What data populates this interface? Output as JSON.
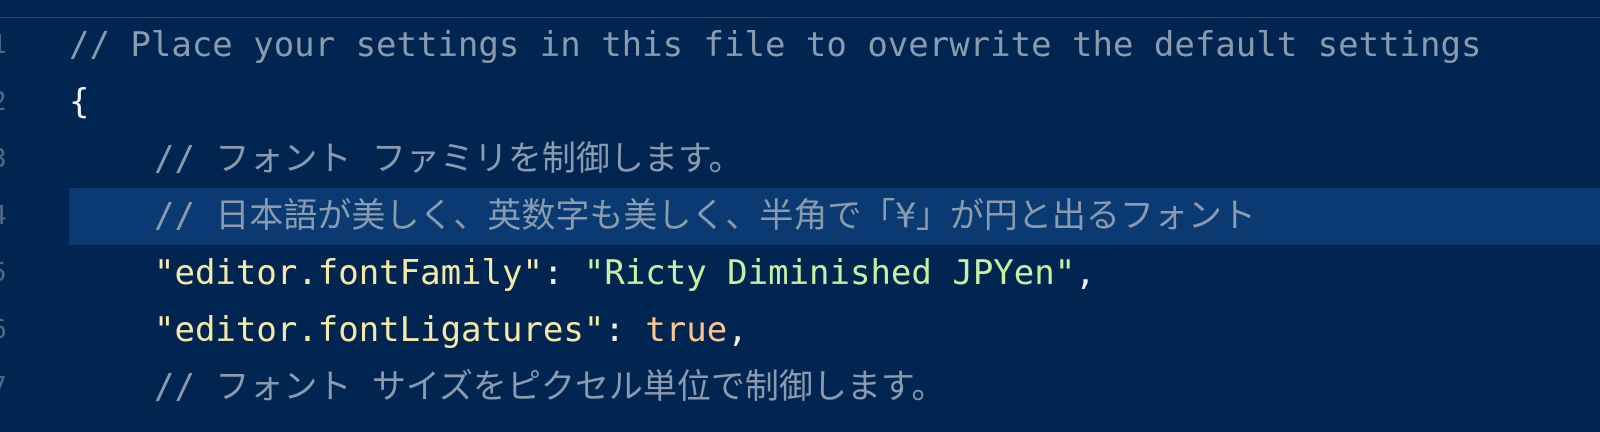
{
  "colors": {
    "background": "#012551",
    "current_line": "#0b3a73",
    "comment": "#8a9bb0",
    "punctuation": "#f0f2f5",
    "property_key": "#f6e9a8",
    "string": "#c8f0a3",
    "boolean": "#ffc58f",
    "line_number": "#4f6a86"
  },
  "lines": [
    {
      "number": "1",
      "comment": "// Place your settings in this file to overwrite the default settings"
    },
    {
      "number": "2",
      "brace": "{"
    },
    {
      "number": "3",
      "comment": "// フォント ファミリを制御します。"
    },
    {
      "number": "4",
      "comment": "// 日本語が美しく、英数字も美しく、半角で「¥」が円と出るフォント"
    },
    {
      "number": "5",
      "key": "\"editor.fontFamily\"",
      "colon": ": ",
      "value": "\"Ricty Diminished JPYen\"",
      "comma": ","
    },
    {
      "number": "6",
      "key": "\"editor.fontLigatures\"",
      "colon": ": ",
      "value": "true",
      "comma": ","
    },
    {
      "number": "7",
      "comment": "// フォント サイズをピクセル単位で制御します。"
    }
  ]
}
